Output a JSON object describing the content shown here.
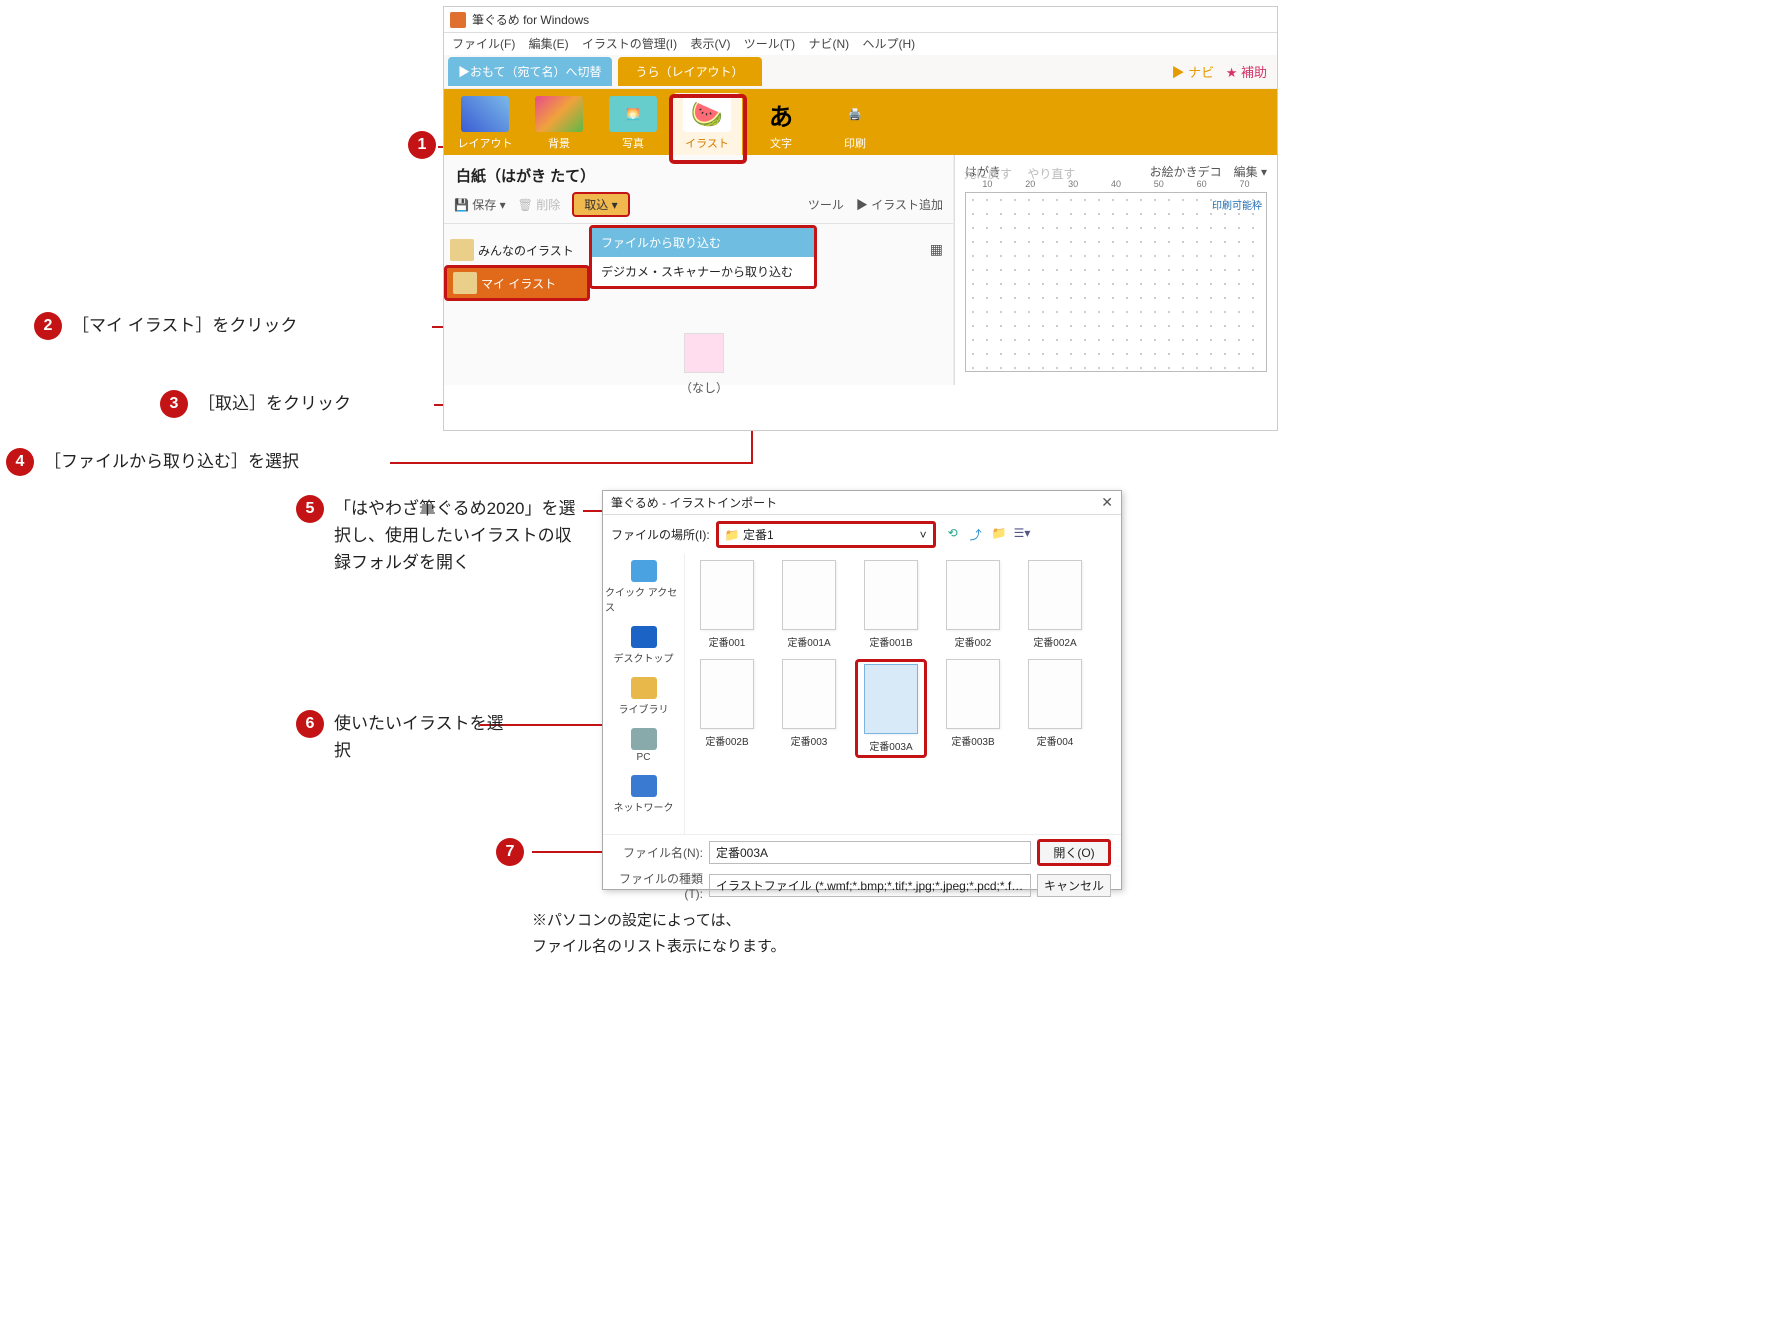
{
  "app": {
    "title": "筆ぐるめ for Windows",
    "menu": [
      "ファイル(F)",
      "編集(E)",
      "イラストの管理(I)",
      "表示(V)",
      "ツール(T)",
      "ナビ(N)",
      "ヘルプ(H)"
    ],
    "tab_omote": "▶おもて（宛て名）へ切替",
    "tab_ura": "うら（レイアウト）",
    "nav_navi": "▶ ナビ",
    "nav_hojo": "★ 補助",
    "tools": {
      "layout": "レイアウト",
      "bg": "背景",
      "photo": "写真",
      "illust": "イラスト",
      "text": "文字",
      "print": "印刷"
    },
    "docname": "白紙（はがき たて）",
    "undo": "元に戻す",
    "redo": "やり直す",
    "sub_save": "保存",
    "sub_del": "削除",
    "sub_import": "取込",
    "sub_tool": "ツール",
    "sub_addillust": "イラスト追加",
    "cat_all": "みんなのイラスト",
    "cat_my": "マイ イラスト",
    "dd_file": "ファイルから取り込む",
    "dd_scan": "デジカメ・スキャナーから取り込む",
    "none": "（なし）",
    "rpanel": "はがき",
    "rdeco": "お絵かきデコ",
    "redit": "編集",
    "ruler": [
      "10",
      "20",
      "30",
      "40",
      "50",
      "60",
      "70"
    ],
    "pframe": "印刷可能枠"
  },
  "dialog": {
    "title": "筆ぐるめ - イラストインポート",
    "loc_label": "ファイルの場所(I):",
    "loc_value": "定番1",
    "side": [
      {
        "k": "quickaccess",
        "label": "クイック アクセス"
      },
      {
        "k": "desktop",
        "label": "デスクトップ"
      },
      {
        "k": "library",
        "label": "ライブラリ"
      },
      {
        "k": "pc",
        "label": "PC"
      },
      {
        "k": "network",
        "label": "ネットワーク"
      }
    ],
    "files": [
      "定番001",
      "定番001A",
      "定番001B",
      "定番002",
      "定番002A",
      "定番002B",
      "定番003",
      "定番003A",
      "定番003B",
      "定番004"
    ],
    "selected_index": 7,
    "fn_label": "ファイル名(N):",
    "fn_value": "定番003A",
    "ft_label": "ファイルの種類(T):",
    "ft_value": "イラストファイル (*.wmf;*.bmp;*.tif;*.jpg;*.jpeg;*.pcd;*.fpx;*",
    "open": "開く(O)",
    "cancel": "キャンセル"
  },
  "callouts": {
    "c2": "［マイ イラスト］をクリック",
    "c3": "［取込］をクリック",
    "c4": "［ファイルから取り込む］を選択",
    "c5": "「はやわざ筆ぐるめ2020」を選択し、使用したいイラストの収録フォルダを開く",
    "c6": "使いたいイラストを選択",
    "note": "※パソコンの設定によっては、\nファイル名のリスト表示になります。"
  }
}
